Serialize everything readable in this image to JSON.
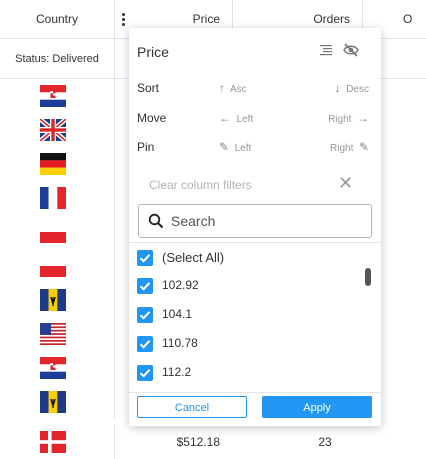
{
  "grid": {
    "headers": {
      "country": "Country",
      "price": "Price",
      "orders": "Orders",
      "next": "O"
    },
    "filter": {
      "country": "Status: Delivered"
    },
    "rows": [
      {
        "flag": "croatia"
      },
      {
        "flag": "uk"
      },
      {
        "flag": "germany"
      },
      {
        "flag": "france"
      },
      {
        "flag": "poland"
      },
      {
        "flag": "poland"
      },
      {
        "flag": "barbados"
      },
      {
        "flag": "usa"
      },
      {
        "flag": "croatia"
      },
      {
        "flag": "barbados"
      },
      {
        "flag": "denmark",
        "price": "$512.18",
        "orders": "23"
      }
    ]
  },
  "popup": {
    "title": "Price",
    "icons": {
      "list": "list-icon",
      "hide": "eye-off-icon"
    },
    "sort": {
      "label": "Sort",
      "asc": "Asc",
      "desc": "Desc"
    },
    "move": {
      "label": "Move",
      "left": "Left",
      "right": "Right"
    },
    "pin": {
      "label": "Pin",
      "left": "Left",
      "right": "Right"
    },
    "clear_filters": "Clear column filters",
    "search": {
      "placeholder": "Search",
      "value": ""
    },
    "select_all": "(Select All)",
    "values": [
      "102.92",
      "104.1",
      "110.78",
      "112.2"
    ],
    "checked": true,
    "cancel": "Cancel",
    "apply": "Apply"
  },
  "colors": {
    "accent": "#2196f3",
    "border": "#dde2eb"
  }
}
